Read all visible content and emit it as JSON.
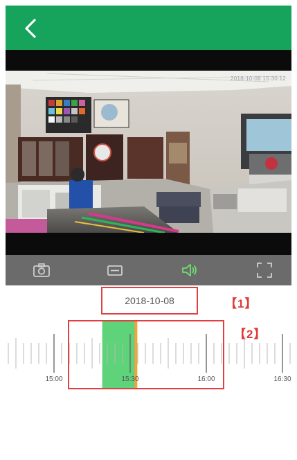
{
  "colors": {
    "header": "#16a35c",
    "recorded_segment": "#5ed37a",
    "playhead": "#f2a33a",
    "annotation": "#e04040"
  },
  "header": {
    "back_icon": "chevron-left-icon"
  },
  "video": {
    "watermark": "2018-10-08 15:30:12"
  },
  "controls": {
    "items": [
      {
        "icon": "camera-icon",
        "active": false
      },
      {
        "icon": "record-icon",
        "active": false
      },
      {
        "icon": "speaker-icon",
        "active": true
      },
      {
        "icon": "fullscreen-icon",
        "active": false
      }
    ]
  },
  "date_selector": {
    "value": "2018-10-08"
  },
  "annotations": {
    "label_1": "【1】",
    "label_2": "【2】"
  },
  "timeline": {
    "labels": [
      "15:00",
      "15:30",
      "16:00",
      "16:30"
    ],
    "recorded_segment": {
      "start": "15:19",
      "end": "15:32"
    }
  }
}
